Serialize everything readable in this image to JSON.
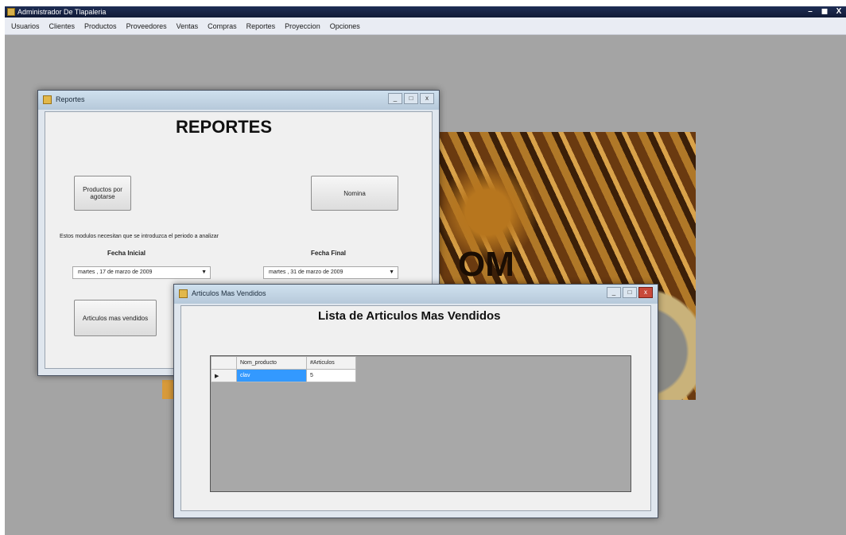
{
  "app": {
    "title": "Administrador De Tlapaleria",
    "window_buttons": [
      "–",
      "◼",
      "X"
    ]
  },
  "menu": [
    "Usuarios",
    "Clientes",
    "Productos",
    "Proveedores",
    "Ventas",
    "Compras",
    "Reportes",
    "Proyeccion",
    "Opciones"
  ],
  "background_image": {
    "text": "OM"
  },
  "reportes_window": {
    "title": "Reportes",
    "heading": "REPORTES",
    "btn_productos": "Productos por agotarse",
    "btn_nomina": "Nomina",
    "note": "Estos modulos necesitan que se introduzca el periodo a analizar",
    "fecha_inicial_label": "Fecha Inicial",
    "fecha_final_label": "Fecha Final",
    "fecha_inicial_value": "martes , 17 de   marzo   de 2009",
    "fecha_final_value": "martes , 31 de   marzo   de 2009",
    "btn_articulos": "Articulos mas vendidos"
  },
  "articulos_window": {
    "title": "Articulos Mas Vendidos",
    "heading": "Lista de Articulos Mas Vendidos",
    "columns": [
      "Nom_producto",
      "#Articulos"
    ],
    "rows": [
      {
        "indicator": "▶",
        "nom_producto": "clav",
        "articulos": "5"
      }
    ]
  }
}
